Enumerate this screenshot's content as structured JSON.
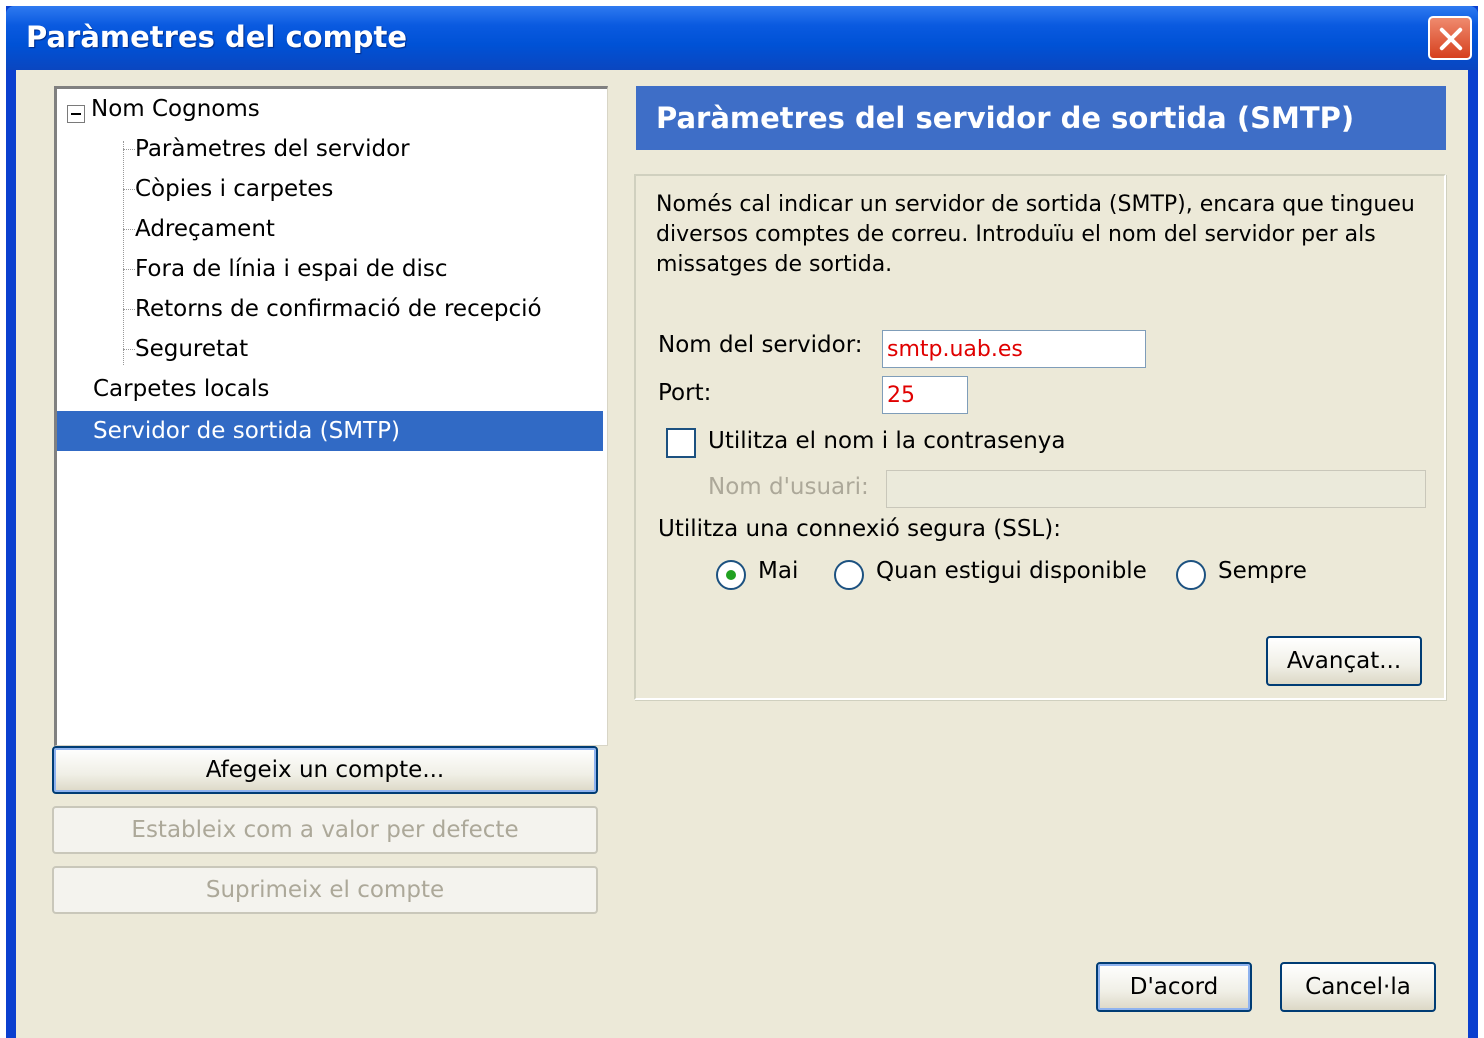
{
  "window": {
    "title": "Paràmetres del compte"
  },
  "tree": {
    "account": "Nom Cognoms",
    "children": [
      "Paràmetres del servidor",
      "Còpies i carpetes",
      "Adreçament",
      "Fora de línia i espai de disc",
      "Retorns de confirmació de recepció",
      "Seguretat"
    ],
    "local_folders": "Carpetes locals",
    "smtp": "Servidor de sortida (SMTP)"
  },
  "left_buttons": {
    "add_account": "Afegeix un compte...",
    "set_default": "Estableix com a valor per defecte",
    "delete_account": "Suprimeix el compte"
  },
  "panel": {
    "header": "Paràmetres del servidor de sortida (SMTP)",
    "description": "Només cal indicar un servidor de sortida (SMTP), encara que tingueu diversos comptes de correu. Introduïu el nom del servidor per als missatges de sortida.",
    "server_label": "Nom del servidor:",
    "server_value": "smtp.uab.es",
    "port_label": "Port:",
    "port_value": "25",
    "use_auth_label": "Utilitza el nom i la contrasenya",
    "use_auth_checked": false,
    "username_label": "Nom d'usuari:",
    "username_value": "",
    "ssl_label": "Utilitza una connexió segura (SSL):",
    "ssl_options": [
      "Mai",
      "Quan estigui disponible",
      "Sempre"
    ],
    "ssl_selected": "Mai",
    "advanced_button": "Avançat..."
  },
  "footer": {
    "ok_button": "D'acord",
    "cancel_button": "Cancel·la"
  }
}
